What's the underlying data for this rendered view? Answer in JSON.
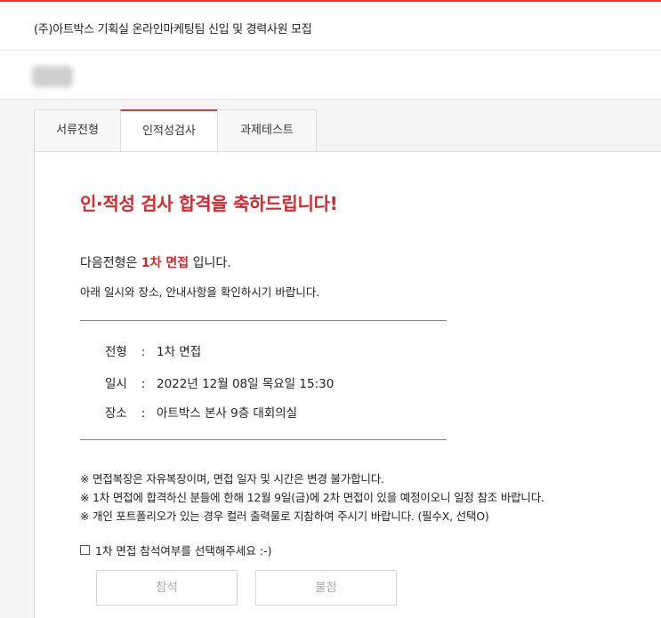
{
  "header": {
    "title": "(주)아트박스 기획실 온라인마케팅팀 신입 및 경력사원 모집"
  },
  "tabs": [
    {
      "label": "서류전형",
      "active": false
    },
    {
      "label": "인적성검사",
      "active": true
    },
    {
      "label": "과제테스트",
      "active": false
    }
  ],
  "result": {
    "headline": "인·적성 검사 합격을 축하드립니다!",
    "next_prefix": "다음전형은 ",
    "next_stage": "1차 면접",
    "next_suffix": " 입니다.",
    "guide": "아래 일시와 장소, 안내사항을 확인하시기 바랍니다."
  },
  "details": [
    {
      "label": "전형",
      "value": "1차 면접"
    },
    {
      "label": "일시",
      "value": "2022년 12월 08일 목요일 15:30"
    },
    {
      "label": "장소",
      "value": "아트박스 본사 9층 대회의실"
    }
  ],
  "separator": ":",
  "notes": [
    "※ 면접복장은 자유복장이며, 면접 일자 및 시간은 변경 불가합니다.",
    "※ 1차 면접에 합격하신 분들에 한해 12월 9일(금)에 2차 면접이 있을 예정이오니 일정 참조 바랍니다.",
    "※ 개인 포트폴리오가 있는 경우 컬러 출력물로 지참하여 주시기 바랍니다. (필수X, 선택O)"
  ],
  "attendance": {
    "question": "1차 면접 참석여부를 선택해주세요 :-)",
    "attend_label": "참석",
    "decline_label": "불참"
  },
  "colors": {
    "accent": "#d8262b"
  }
}
